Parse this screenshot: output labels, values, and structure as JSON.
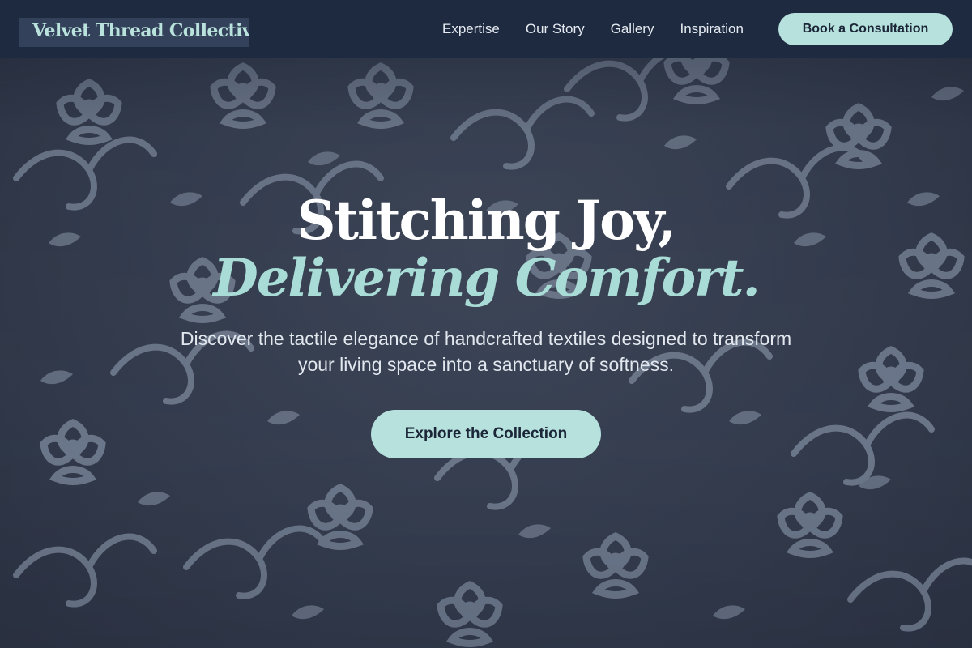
{
  "header": {
    "logo_text": "Velvet Thread Collective",
    "nav": [
      {
        "label": "Expertise"
      },
      {
        "label": "Our Story"
      },
      {
        "label": "Gallery"
      },
      {
        "label": "Inspiration"
      }
    ],
    "cta_label": "Book a Consultation"
  },
  "hero": {
    "headline_line1": "Stitching Joy,",
    "headline_line2": "Delivering Comfort.",
    "subtext": "Discover the tactile elegance of handcrafted textiles designed to transform your living space into a sanctuary of softness.",
    "cta_label": "Explore the Collection"
  },
  "colors": {
    "header_bg": "#1e2a3f",
    "accent": "#b6e1dc",
    "page_bg": "#3d4557",
    "pattern": "#7a8699"
  }
}
